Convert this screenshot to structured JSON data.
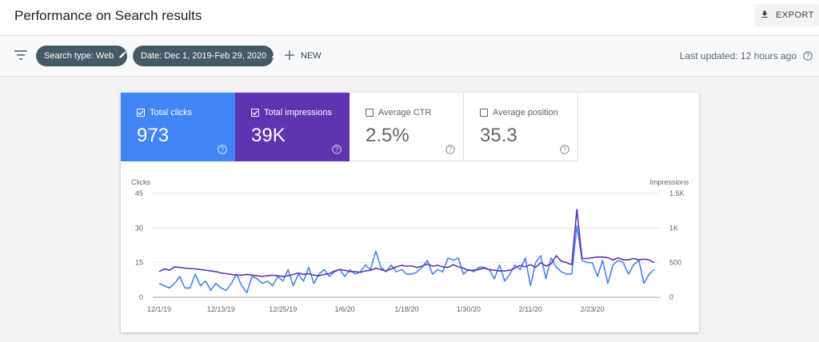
{
  "header": {
    "title": "Performance on Search results",
    "export_label": "EXPORT"
  },
  "toolbar": {
    "chips": [
      "Search type: Web",
      "Date: Dec 1, 2019-Feb 29, 2020"
    ],
    "new_label": "NEW",
    "last_updated": "Last updated: 12 hours ago"
  },
  "metrics": [
    {
      "label": "Total clicks",
      "value": "973",
      "checked": true,
      "color": "#4285f4"
    },
    {
      "label": "Total impressions",
      "value": "39K",
      "checked": true,
      "color": "#5e35b1"
    },
    {
      "label": "Average CTR",
      "value": "2.5%",
      "checked": false
    },
    {
      "label": "Average position",
      "value": "35.3",
      "checked": false
    }
  ],
  "icons": {
    "filter": "filter-icon",
    "export": "download-icon",
    "edit": "pencil-icon",
    "add": "plus-icon",
    "help": "help-circle-icon"
  },
  "chart_data": {
    "type": "line",
    "ylabel_left": "Clicks",
    "ylabel_right": "Impressions",
    "left_ticks": [
      "0",
      "15",
      "30",
      "45"
    ],
    "right_ticks": [
      "0",
      "500",
      "1K",
      "1.5K"
    ],
    "ylim_left": [
      0,
      45
    ],
    "ylim_right": [
      0,
      1500
    ],
    "x_ticks": [
      "12/1/19",
      "12/13/19",
      "12/25/19",
      "1/6/20",
      "1/18/20",
      "1/30/20",
      "2/11/20",
      "2/23/20"
    ],
    "grid": true,
    "series": [
      {
        "name": "Clicks",
        "axis": "left",
        "color": "#4285f4",
        "values": [
          6,
          5,
          4,
          6,
          9,
          4,
          4,
          10,
          5,
          7,
          3,
          6,
          4,
          3,
          6,
          10,
          5,
          2,
          9,
          8,
          6,
          7,
          5,
          9,
          7,
          12,
          5,
          10,
          7,
          13,
          6,
          10,
          12,
          9,
          11,
          12,
          9,
          12,
          10,
          11,
          14,
          12,
          20,
          13,
          11,
          14,
          11,
          12,
          10,
          10,
          11,
          13,
          16,
          10,
          12,
          11,
          17,
          16,
          17,
          10,
          12,
          11,
          13,
          13,
          12,
          8,
          14,
          7,
          10,
          14,
          12,
          17,
          5,
          15,
          18,
          8,
          17,
          13,
          11,
          10,
          10,
          31,
          16,
          15,
          15,
          9,
          16,
          6,
          14,
          16,
          15,
          10,
          14,
          16,
          6,
          10,
          12
        ]
      },
      {
        "name": "Impressions",
        "axis": "right",
        "color": "#5e35b1",
        "values": [
          370,
          410,
          390,
          440,
          430,
          420,
          415,
          410,
          400,
          390,
          380,
          370,
          350,
          340,
          330,
          320,
          320,
          330,
          320,
          310,
          300,
          310,
          320,
          310,
          300,
          310,
          330,
          350,
          330,
          340,
          320,
          310,
          330,
          340,
          380,
          400,
          390,
          370,
          370,
          360,
          380,
          390,
          420,
          400,
          380,
          410,
          440,
          460,
          450,
          450,
          430,
          450,
          480,
          450,
          460,
          440,
          430,
          470,
          440,
          420,
          390,
          390,
          400,
          420,
          400,
          390,
          380,
          380,
          390,
          420,
          460,
          440,
          470,
          430,
          500,
          450,
          480,
          600,
          520,
          500,
          470,
          1270,
          560,
          560,
          570,
          580,
          580,
          570,
          540,
          570,
          540,
          540,
          560,
          540,
          550,
          540,
          500
        ]
      }
    ]
  }
}
